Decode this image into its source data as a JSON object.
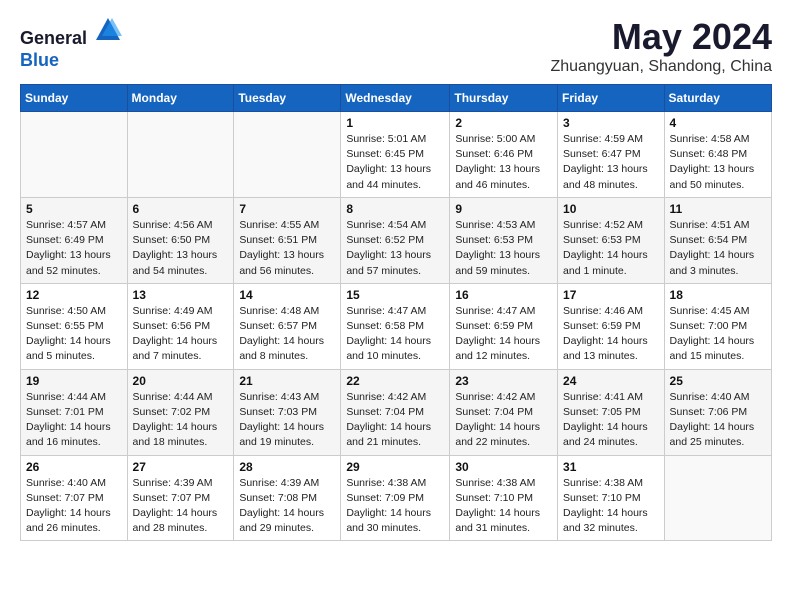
{
  "header": {
    "logo_line1": "General",
    "logo_line2": "Blue",
    "main_title": "May 2024",
    "subtitle": "Zhuangyuan, Shandong, China"
  },
  "calendar": {
    "days_of_week": [
      "Sunday",
      "Monday",
      "Tuesday",
      "Wednesday",
      "Thursday",
      "Friday",
      "Saturday"
    ],
    "weeks": [
      [
        {
          "day": "",
          "info": ""
        },
        {
          "day": "",
          "info": ""
        },
        {
          "day": "",
          "info": ""
        },
        {
          "day": "1",
          "info": "Sunrise: 5:01 AM\nSunset: 6:45 PM\nDaylight: 13 hours\nand 44 minutes."
        },
        {
          "day": "2",
          "info": "Sunrise: 5:00 AM\nSunset: 6:46 PM\nDaylight: 13 hours\nand 46 minutes."
        },
        {
          "day": "3",
          "info": "Sunrise: 4:59 AM\nSunset: 6:47 PM\nDaylight: 13 hours\nand 48 minutes."
        },
        {
          "day": "4",
          "info": "Sunrise: 4:58 AM\nSunset: 6:48 PM\nDaylight: 13 hours\nand 50 minutes."
        }
      ],
      [
        {
          "day": "5",
          "info": "Sunrise: 4:57 AM\nSunset: 6:49 PM\nDaylight: 13 hours\nand 52 minutes."
        },
        {
          "day": "6",
          "info": "Sunrise: 4:56 AM\nSunset: 6:50 PM\nDaylight: 13 hours\nand 54 minutes."
        },
        {
          "day": "7",
          "info": "Sunrise: 4:55 AM\nSunset: 6:51 PM\nDaylight: 13 hours\nand 56 minutes."
        },
        {
          "day": "8",
          "info": "Sunrise: 4:54 AM\nSunset: 6:52 PM\nDaylight: 13 hours\nand 57 minutes."
        },
        {
          "day": "9",
          "info": "Sunrise: 4:53 AM\nSunset: 6:53 PM\nDaylight: 13 hours\nand 59 minutes."
        },
        {
          "day": "10",
          "info": "Sunrise: 4:52 AM\nSunset: 6:53 PM\nDaylight: 14 hours\nand 1 minute."
        },
        {
          "day": "11",
          "info": "Sunrise: 4:51 AM\nSunset: 6:54 PM\nDaylight: 14 hours\nand 3 minutes."
        }
      ],
      [
        {
          "day": "12",
          "info": "Sunrise: 4:50 AM\nSunset: 6:55 PM\nDaylight: 14 hours\nand 5 minutes."
        },
        {
          "day": "13",
          "info": "Sunrise: 4:49 AM\nSunset: 6:56 PM\nDaylight: 14 hours\nand 7 minutes."
        },
        {
          "day": "14",
          "info": "Sunrise: 4:48 AM\nSunset: 6:57 PM\nDaylight: 14 hours\nand 8 minutes."
        },
        {
          "day": "15",
          "info": "Sunrise: 4:47 AM\nSunset: 6:58 PM\nDaylight: 14 hours\nand 10 minutes."
        },
        {
          "day": "16",
          "info": "Sunrise: 4:47 AM\nSunset: 6:59 PM\nDaylight: 14 hours\nand 12 minutes."
        },
        {
          "day": "17",
          "info": "Sunrise: 4:46 AM\nSunset: 6:59 PM\nDaylight: 14 hours\nand 13 minutes."
        },
        {
          "day": "18",
          "info": "Sunrise: 4:45 AM\nSunset: 7:00 PM\nDaylight: 14 hours\nand 15 minutes."
        }
      ],
      [
        {
          "day": "19",
          "info": "Sunrise: 4:44 AM\nSunset: 7:01 PM\nDaylight: 14 hours\nand 16 minutes."
        },
        {
          "day": "20",
          "info": "Sunrise: 4:44 AM\nSunset: 7:02 PM\nDaylight: 14 hours\nand 18 minutes."
        },
        {
          "day": "21",
          "info": "Sunrise: 4:43 AM\nSunset: 7:03 PM\nDaylight: 14 hours\nand 19 minutes."
        },
        {
          "day": "22",
          "info": "Sunrise: 4:42 AM\nSunset: 7:04 PM\nDaylight: 14 hours\nand 21 minutes."
        },
        {
          "day": "23",
          "info": "Sunrise: 4:42 AM\nSunset: 7:04 PM\nDaylight: 14 hours\nand 22 minutes."
        },
        {
          "day": "24",
          "info": "Sunrise: 4:41 AM\nSunset: 7:05 PM\nDaylight: 14 hours\nand 24 minutes."
        },
        {
          "day": "25",
          "info": "Sunrise: 4:40 AM\nSunset: 7:06 PM\nDaylight: 14 hours\nand 25 minutes."
        }
      ],
      [
        {
          "day": "26",
          "info": "Sunrise: 4:40 AM\nSunset: 7:07 PM\nDaylight: 14 hours\nand 26 minutes."
        },
        {
          "day": "27",
          "info": "Sunrise: 4:39 AM\nSunset: 7:07 PM\nDaylight: 14 hours\nand 28 minutes."
        },
        {
          "day": "28",
          "info": "Sunrise: 4:39 AM\nSunset: 7:08 PM\nDaylight: 14 hours\nand 29 minutes."
        },
        {
          "day": "29",
          "info": "Sunrise: 4:38 AM\nSunset: 7:09 PM\nDaylight: 14 hours\nand 30 minutes."
        },
        {
          "day": "30",
          "info": "Sunrise: 4:38 AM\nSunset: 7:10 PM\nDaylight: 14 hours\nand 31 minutes."
        },
        {
          "day": "31",
          "info": "Sunrise: 4:38 AM\nSunset: 7:10 PM\nDaylight: 14 hours\nand 32 minutes."
        },
        {
          "day": "",
          "info": ""
        }
      ]
    ]
  }
}
